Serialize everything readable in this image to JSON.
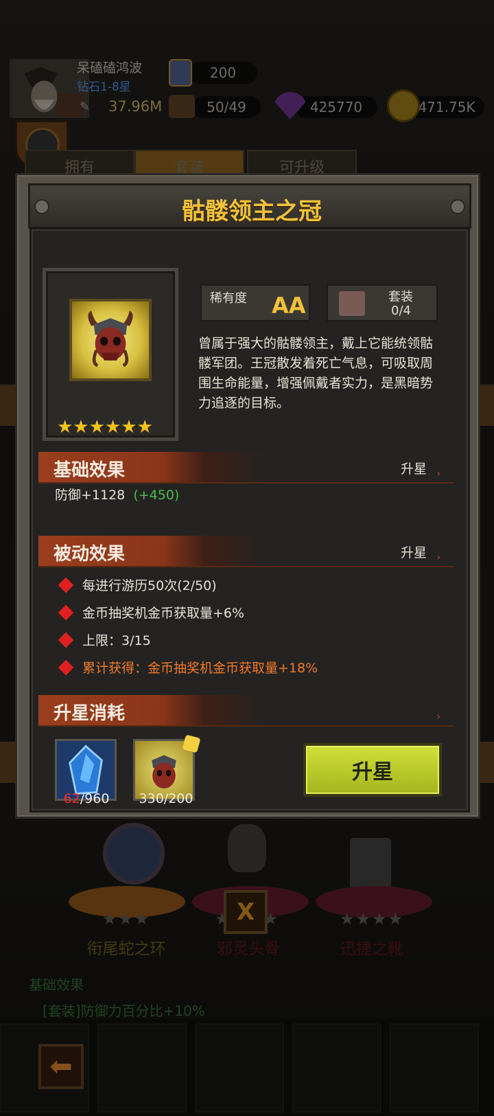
{
  "player": {
    "name": "呆磕磕鸿波",
    "rank": "钻石1-8星",
    "power": "37.96M"
  },
  "resources": {
    "badge_value": "200",
    "stamina": "50/49",
    "gems": "425770",
    "coins": "471.75K"
  },
  "tabs": [
    "拥有",
    "套装",
    "可升级"
  ],
  "modal": {
    "title": "骷髅领主之冠",
    "rarity_label": "稀有度",
    "rarity_value": "AA",
    "set_label": "套装",
    "set_value": "0/4",
    "stars": "★★★★★★",
    "description": "曾属于强大的骷髅领主，戴上它能统领骷髅军团。王冠散发着死亡气息，可吸取周围生命能量，增强佩戴者实力，是黑暗势力追逐的目标。",
    "base_effect": {
      "title": "基础效果",
      "action": "升星",
      "stat": "防御+1128",
      "bonus": "(+450)"
    },
    "passive_effect": {
      "title": "被动效果",
      "action": "升星",
      "lines": [
        "每进行游历50次(2/50)",
        "金币抽奖机金币获取量+6%",
        "上限：3/15",
        "累计获得：金币抽奖机金币获取量+18%"
      ]
    },
    "upgrade_cost": {
      "title": "升星消耗",
      "crystal_have": "62",
      "crystal_need": "/960",
      "item_count": "330/200"
    },
    "upgrade_button": "升星"
  },
  "background_items": [
    {
      "name": "衔尾蛇之环",
      "stars": "★★★"
    },
    {
      "name": "邪灵头骨",
      "stars": "★★★★"
    },
    {
      "name": "迅捷之靴",
      "stars": "★★★★"
    }
  ],
  "background_effect": {
    "title": "基础效果",
    "line": "[套装]防御力百分比+10%"
  },
  "colors": {
    "title_gold": "#f2c23a",
    "section_red": "#9a3e1e",
    "bonus_green": "#4ac04a",
    "accent_orange": "#f07a2a",
    "button_lime": "#cfe03a"
  }
}
